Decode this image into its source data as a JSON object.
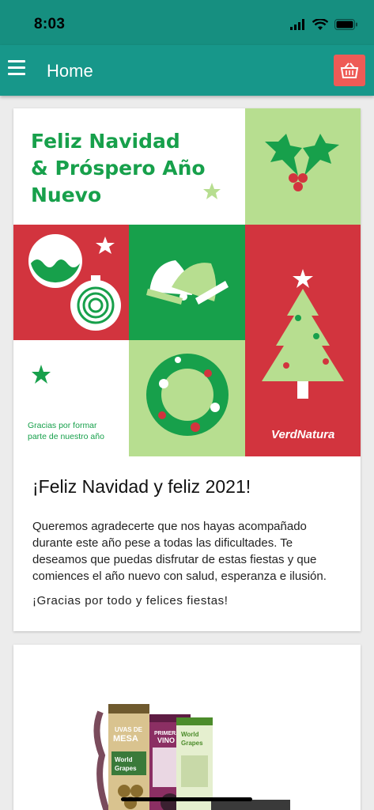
{
  "status": {
    "time": "8:03"
  },
  "appbar": {
    "title": "Home"
  },
  "banner": {
    "headline_line1": "Feliz Navidad",
    "headline_line2": "& Próspero Año",
    "headline_line3": "Nuevo",
    "thanks_line1": "Gracias por formar",
    "thanks_line2": "parte de nuestro año",
    "brand": "VerdNatura"
  },
  "post": {
    "title": "¡Feliz Navidad y feliz 2021!",
    "body": "Queremos agradecerte que nos hayas acompañado durante este año pese a todas las dificultades. Te deseamos que puedas disfrutar de estas fiestas y que comiences el año nuevo con salud, esperanza e ilusión.",
    "footer": "¡Gracias por todo y felices fiestas!"
  },
  "product_banner": {
    "box1_line1": "UVAS DE",
    "box1_line2": "MESA",
    "box2_line1": "PRIMERA",
    "box2_line2": "VINO",
    "brand_line1": "World",
    "brand_line2": "Grapes"
  },
  "colors": {
    "teal": "#17978a",
    "red": "#d2343e",
    "green": "#17a04b",
    "light_green": "#b7de90",
    "cart": "#ee5b56"
  },
  "icons": [
    "menu-icon",
    "cart-icon",
    "wifi-icon",
    "signal-icon",
    "battery-icon"
  ]
}
